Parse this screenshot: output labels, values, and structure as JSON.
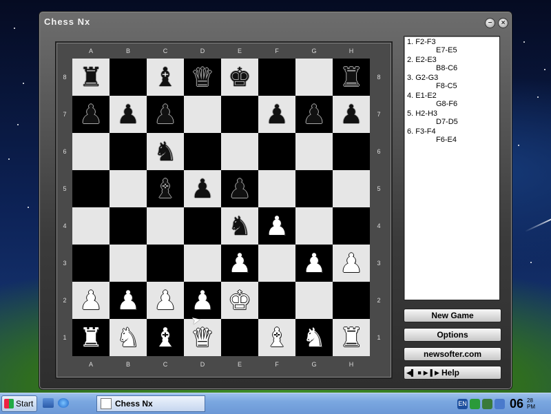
{
  "window": {
    "title": "Chess Nx",
    "minimize_icon": "minimize-icon",
    "close_icon": "close-icon"
  },
  "board": {
    "files": [
      "A",
      "B",
      "C",
      "D",
      "E",
      "F",
      "G",
      "H"
    ],
    "ranks": [
      "8",
      "7",
      "6",
      "5",
      "4",
      "3",
      "2",
      "1"
    ],
    "rows": [
      [
        "bR",
        "",
        "bB",
        "bQ",
        "bK",
        "",
        "",
        "bR"
      ],
      [
        "bP",
        "bP",
        "bP",
        "",
        "",
        "bP",
        "bP",
        "bP"
      ],
      [
        "",
        "",
        "bN",
        "",
        "",
        "",
        "",
        ""
      ],
      [
        "",
        "",
        "bB",
        "bP",
        "bP",
        "",
        "",
        ""
      ],
      [
        "",
        "",
        "",
        "",
        "bN",
        "wP",
        "",
        ""
      ],
      [
        "",
        "",
        "",
        "",
        "wP",
        "",
        "wP",
        "wP"
      ],
      [
        "wP",
        "wP",
        "wP",
        "wP",
        "wK",
        "",
        "",
        ""
      ],
      [
        "wR",
        "wN",
        "wB",
        "wQ",
        "",
        "wB",
        "wN",
        "wR"
      ]
    ]
  },
  "moves": [
    {
      "white": "1. F2-F3",
      "black": "E7-E5"
    },
    {
      "white": "2. E2-E3",
      "black": "B8-C6"
    },
    {
      "white": "3. G2-G3",
      "black": "F8-C5"
    },
    {
      "white": "4. E1-E2",
      "black": "G8-F6"
    },
    {
      "white": "5. H2-H3",
      "black": "D7-D5"
    },
    {
      "white": "6. F3-F4",
      "black": "F6-E4"
    }
  ],
  "buttons": {
    "new_game": "New Game",
    "options": "Options",
    "website": "newsofter.com",
    "help": "Help"
  },
  "taskbar": {
    "start": "Start",
    "task": "Chess Nx",
    "lang": "EN",
    "time": "06",
    "time_small": "28",
    "ampm": "PM"
  }
}
